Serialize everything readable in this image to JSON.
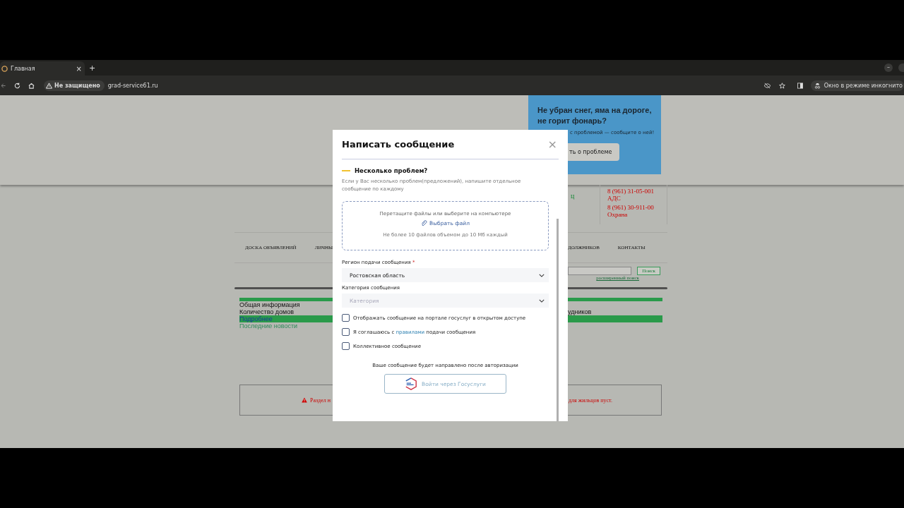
{
  "browser": {
    "tab": {
      "title": "Главная",
      "close": "×"
    },
    "new_tab": "+",
    "window_minimize": "–",
    "security_chip": "Не защищено",
    "url": "grad-service61.ru",
    "incognito": "Окно в режиме инкогнито"
  },
  "background_page": {
    "banner": {
      "title": "Не убран снег, яма на дороге, не горит фонарь?",
      "text": "с проблемой — сообщите о ней!",
      "button": "ть о проблеме"
    },
    "fragment_link": "ц",
    "phones": [
      {
        "number": "8 (961) 31-05-001",
        "label": "АДС"
      },
      {
        "number": "8 (961) 30-911-00",
        "label": "Охрана"
      }
    ],
    "nav_left": [
      "ДОСКА ОБЪЯВЛЕНИЙ",
      "ЛИЧНЫ"
    ],
    "nav_right": [
      "ДОЛЖНИКОВ",
      "КОНТАКТЫ"
    ],
    "search_button": "Поиск",
    "advanced_search": "расширенный поиск",
    "info_rows": [
      {
        "left": "Общая информация",
        "right": "",
        "highlighted": false
      },
      {
        "left": "Количество домов",
        "right": "удников",
        "highlighted": false
      },
      {
        "left": "Подробнее",
        "right": "",
        "highlighted": true
      }
    ],
    "news_link": "Последние новости",
    "warning": {
      "left": "Раздел н",
      "right": "для жильцов пуст."
    }
  },
  "modal": {
    "title": "Написать сообщение",
    "close": "×",
    "notice": {
      "title": "Несколько проблем?",
      "text": "Если у Вас несколько проблем(предложений), напишите отдельное сообщение по каждому"
    },
    "upload": {
      "hint": "Перетащите файлы или выберите на компьютере",
      "button": "Выбрать файл",
      "limit": "Не более 10 файлов объемом до 10 Мб каждый"
    },
    "fields": [
      {
        "label": "Регион подачи сообщения",
        "required_mark": "*",
        "value": "Ростовская область"
      },
      {
        "label": "Категория сообщения",
        "placeholder": "Категория"
      }
    ],
    "checkboxes": [
      {
        "kind": "plain",
        "text": "Отображать сообщение на портале госуслуг в открытом доступе",
        "checked": false
      },
      {
        "kind": "link",
        "text_before": "Я соглашаюсь с",
        "link": "правилами",
        "text_after": "подачи сообщения",
        "checked": false
      },
      {
        "kind": "plain",
        "text": "Коллективное сообщение",
        "checked": false
      }
    ],
    "auth_note": "Ваше сообщение будет направлено после авторизации",
    "login_button": "Войти через Госуслуги"
  }
}
